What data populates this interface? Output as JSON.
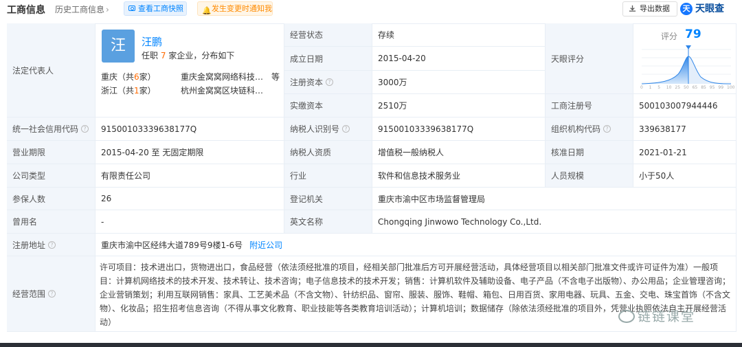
{
  "header": {
    "title": "工商信息",
    "history_link": "历史工商信息",
    "history_chevron": "›",
    "snapshot_button": "查看工商快照",
    "notify_button": "发生变更时通知我",
    "export_button": "导出数据",
    "logo_text": "天眼查"
  },
  "rep": {
    "label": "法定代表人",
    "avatar_char": "汪",
    "name": "汪鹏",
    "summary_pre": "任职",
    "summary_count": "7",
    "summary_post": "家企业，分布如下",
    "regions": [
      {
        "region_pre": "重庆（共",
        "count": "6",
        "region_post": "家）",
        "company": "重庆金窝窝网络科技…",
        "more": "等"
      },
      {
        "region_pre": "浙江（共",
        "count": "1",
        "region_post": "家）",
        "company": "杭州金窝窝区块链科…",
        "more": ""
      }
    ]
  },
  "fields": {
    "status_label": "经营状态",
    "status_value": "存续",
    "found_label": "成立日期",
    "found_value": "2015-04-20",
    "regcap_label": "注册资本",
    "regcap_value": "3000万",
    "paidcap_label": "实缴资本",
    "paidcap_value": "2510万",
    "score_label": "天眼评分",
    "score_word": "评分",
    "score_value": "79",
    "score_ticks": [
      "0",
      "1",
      "5",
      "10",
      "25",
      "50",
      "65",
      "85",
      "95",
      "99",
      "100"
    ],
    "regno_label": "工商注册号",
    "regno_value": "500103007944446",
    "credit_label": "统一社会信用代码",
    "credit_value": "91500103339638177Q",
    "taxid_label": "纳税人识别号",
    "taxid_value": "91500103339638177Q",
    "org_label": "组织机构代码",
    "org_value": "339638177",
    "term_label": "营业期限",
    "term_value": "2015-04-20 至 无固定期限",
    "taxq_label": "纳税人资质",
    "taxq_value": "增值税一般纳税人",
    "approve_label": "核准日期",
    "approve_value": "2021-01-21",
    "type_label": "公司类型",
    "type_value": "有限责任公司",
    "industry_label": "行业",
    "industry_value": "软件和信息技术服务业",
    "staff_label": "人员规模",
    "staff_value": "小于50人",
    "insured_label": "参保人数",
    "insured_value": "26",
    "authority_label": "登记机关",
    "authority_value": "重庆市渝中区市场监督管理局",
    "former_label": "曾用名",
    "former_value": "-",
    "en_label": "英文名称",
    "en_value": "Chongqing Jinwowo Technology Co.,Ltd.",
    "addr_label": "注册地址",
    "addr_value": "重庆市渝中区经纬大道789号9楼1-6号",
    "addr_link": "附近公司",
    "scope_label": "经营范围",
    "scope_value": "许可项目：技术进出口，货物进出口，食品经营（依法须经批准的项目，经相关部门批准后方可开展经营活动，具体经营项目以相关部门批准文件或许可证件为准）一般项目：计算机网络技术的技术开发、技术转让、技术咨询；电子信息技术的技术开发；销售：计算机软件及辅助设备、电子产品（不含电子出版物）、办公用品；企业管理咨询；企业营销策划；利用互联网销售：家具、工艺美术品（不含文物）、针纺织品、窗帘、服装、服饰、鞋帽、箱包、日用百货、家用电器、玩具、五金、交电、珠宝首饰（不含文物）、化妆品；招生招考信息咨询（不得从事文化教育、职业技能等各类教育培训活动）；计算机培训；数据储存（除依法须经批准的项目外，凭营业执照依法自主开展经营活动）"
  },
  "watermark": "链链课堂",
  "colors": {
    "accent": "#0084ff",
    "label_bg": "#f2f6fb",
    "highlight": "#ff6a00"
  }
}
